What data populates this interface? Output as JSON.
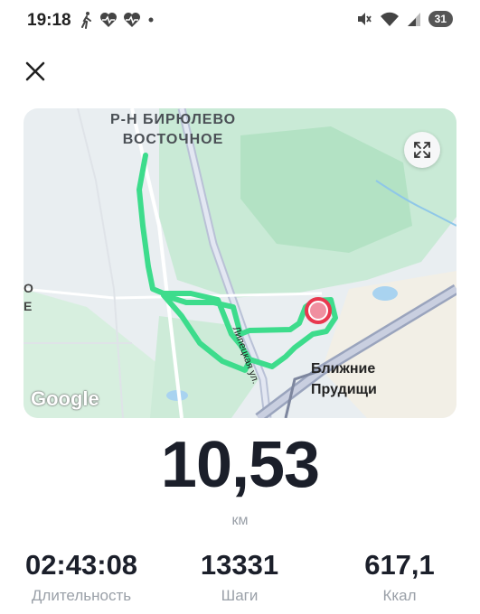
{
  "status_bar": {
    "time": "19:18",
    "icons_left": [
      "walking-icon",
      "heart-rate-icon",
      "heart-rate-icon",
      "dot-icon"
    ],
    "icons_right": [
      "mute-icon",
      "wifi-icon",
      "signal-icon"
    ],
    "battery": "31"
  },
  "header": {
    "close_icon": "close-icon"
  },
  "map": {
    "district_label": "Р-Н БИРЮЛЕВО\nВОСТОЧНОЕ",
    "place_label": "Ближние\nПрудищи",
    "street_label": "Липецкая ул.",
    "edge_label": "О\nЕ",
    "logo": "Google",
    "expand_icon": "expand-icon",
    "route_color": "#3ddc8c",
    "marker_color": "#e8384f"
  },
  "summary": {
    "distance": "10,53",
    "distance_unit": "км"
  },
  "stats": [
    {
      "value": "02:43:08",
      "label": "Длительность"
    },
    {
      "value": "13331",
      "label": "Шаги"
    },
    {
      "value": "617,1",
      "label": "Ккал"
    }
  ]
}
